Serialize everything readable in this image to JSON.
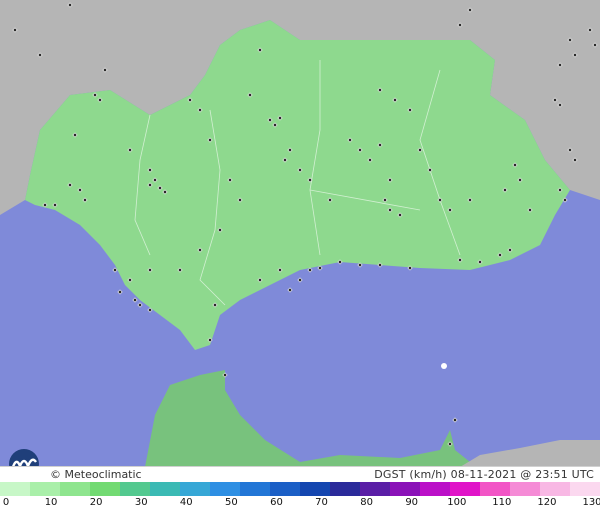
{
  "credit": "© Meteoclimatic",
  "caption": {
    "variable": "DGST (km/h)",
    "date": "08-11-2021",
    "separator": "@",
    "time": "23:51 UTC"
  },
  "legend": {
    "ticks": [
      "0",
      "10",
      "20",
      "30",
      "40",
      "50",
      "60",
      "70",
      "80",
      "90",
      "100",
      "110",
      "120",
      "130"
    ],
    "colors": [
      "#c7f7c7",
      "#a9efa9",
      "#8ee58e",
      "#72da72",
      "#53c98f",
      "#3bbab4",
      "#36a7d6",
      "#2e8fe3",
      "#2276d6",
      "#1b5fc6",
      "#1446b0",
      "#2a2a9a",
      "#5a1ea6",
      "#8a12b8",
      "#bb10c8",
      "#e014c8",
      "#f255c6",
      "#f58bd6",
      "#f8b8e4",
      "#fbd8ef"
    ]
  },
  "map": {
    "colors": {
      "sea": "#7f8ad9",
      "land_other": "#b5b5b5",
      "andalusia": "#8ed98e",
      "morocco": "#78c27d",
      "border": "#ffffff",
      "station": "#222222"
    }
  }
}
